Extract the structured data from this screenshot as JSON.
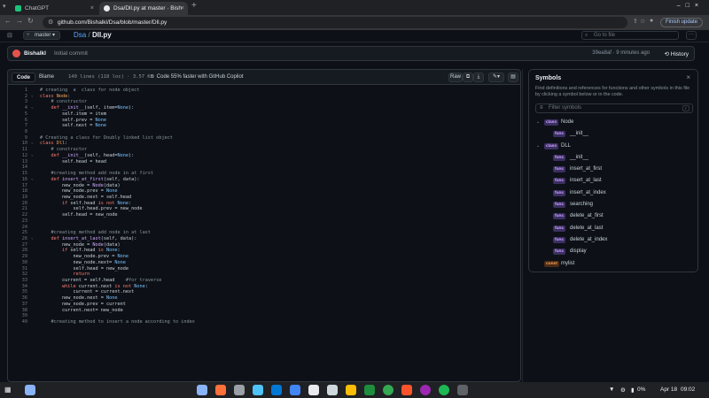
{
  "browser": {
    "tabs": [
      {
        "title": "ChatGPT",
        "favicon_color": "#19c37d"
      },
      {
        "title": "Dsa/Dll.py at master · Bish",
        "favicon_color": "#e8eaed"
      }
    ],
    "new_tab_label": "+",
    "url": "github.com/Bishalkl/Dsa/blob/master/Dll.py",
    "finish_update_label": "Finish update"
  },
  "repo_bar": {
    "branch": "master",
    "repo": "Dsa",
    "separator": "/",
    "file": "Dll.py",
    "goto_placeholder": "Go to file",
    "more_label": "···"
  },
  "commit": {
    "author": "Bishalkl",
    "message": "Initial commit",
    "hash_time": "39ea8af · 9 minutes ago",
    "history_label": "History"
  },
  "code_header": {
    "tab_code": "Code",
    "tab_blame": "Blame",
    "file_info": "140 lines (118 loc) · 3.57 KB",
    "copilot": "Code 55% faster with GitHub Copilot",
    "raw_label": "Raw"
  },
  "code_lines": [
    {
      "n": "1",
      "fold": "",
      "html": "<span class=\"tk-cm\"># creating  a  class for node object</span>"
    },
    {
      "n": "2",
      "fold": "⌄",
      "html": "<span class=\"tk-kw\">class</span> <span class=\"tk-cl\">Node</span>:"
    },
    {
      "n": "3",
      "fold": "",
      "html": "    <span class=\"tk-cm\"># constructor</span>"
    },
    {
      "n": "4",
      "fold": "⌄",
      "html": "    <span class=\"tk-kw\">def</span> <span class=\"tk-fn\">__init__</span>(self, item=<span class=\"tk-bi\">None</span>):"
    },
    {
      "n": "5",
      "fold": "",
      "html": "        self.item = item"
    },
    {
      "n": "6",
      "fold": "",
      "html": "        self.prev = <span class=\"tk-bi\">None</span>"
    },
    {
      "n": "7",
      "fold": "",
      "html": "        self.next = <span class=\"tk-bi\">None</span>"
    },
    {
      "n": "8",
      "fold": "",
      "html": ""
    },
    {
      "n": "9",
      "fold": "",
      "html": "<span class=\"tk-cm\"># Creating a class for Doubly linked list object</span>"
    },
    {
      "n": "10",
      "fold": "⌄",
      "html": "<span class=\"tk-kw\">class</span> <span class=\"tk-cl\">Dll</span>:"
    },
    {
      "n": "11",
      "fold": "",
      "html": "    <span class=\"tk-cm\"># constructor</span>"
    },
    {
      "n": "12",
      "fold": "⌄",
      "html": "    <span class=\"tk-kw\">def</span> <span class=\"tk-fn\">__init__</span>(self, head=<span class=\"tk-bi\">None</span>):"
    },
    {
      "n": "13",
      "fold": "",
      "html": "        self.head = head"
    },
    {
      "n": "14",
      "fold": "",
      "html": ""
    },
    {
      "n": "15",
      "fold": "",
      "html": "    <span class=\"tk-cm\">#creating method add node in at first</span>"
    },
    {
      "n": "16",
      "fold": "⌄",
      "html": "    <span class=\"tk-kw\">def</span> <span class=\"tk-fn\">insert_at_first</span>(self, data):"
    },
    {
      "n": "17",
      "fold": "",
      "html": "        new_node = <span class=\"tk-fn\">Node</span>(data)"
    },
    {
      "n": "18",
      "fold": "",
      "html": "        new_node.prev = <span class=\"tk-bi\">None</span>"
    },
    {
      "n": "19",
      "fold": "",
      "html": "        new_node.next = self.head"
    },
    {
      "n": "20",
      "fold": "",
      "html": "        <span class=\"tk-kw\">if</span> self.head <span class=\"tk-kw\">is not</span> <span class=\"tk-bi\">None</span>:"
    },
    {
      "n": "21",
      "fold": "",
      "html": "            self.head.prev = new_node"
    },
    {
      "n": "22",
      "fold": "",
      "html": "        self.head = new_node"
    },
    {
      "n": "23",
      "fold": "",
      "html": ""
    },
    {
      "n": "24",
      "fold": "",
      "html": ""
    },
    {
      "n": "25",
      "fold": "",
      "html": "    <span class=\"tk-cm\">#creating method add node in at last</span>"
    },
    {
      "n": "26",
      "fold": "⌄",
      "html": "    <span class=\"tk-kw\">def</span> <span class=\"tk-fn\">insert_at_last</span>(self, data):"
    },
    {
      "n": "27",
      "fold": "",
      "html": "        new_node = <span class=\"tk-fn\">Node</span>(data)"
    },
    {
      "n": "28",
      "fold": "",
      "html": "        <span class=\"tk-kw\">if</span> self.head <span class=\"tk-kw\">is</span> <span class=\"tk-bi\">None</span>:"
    },
    {
      "n": "29",
      "fold": "",
      "html": "            new_node.prev = <span class=\"tk-bi\">None</span>"
    },
    {
      "n": "30",
      "fold": "",
      "html": "            new_node.next= <span class=\"tk-bi\">None</span>"
    },
    {
      "n": "31",
      "fold": "",
      "html": "            self.head = new_node"
    },
    {
      "n": "32",
      "fold": "",
      "html": "            <span class=\"tk-kw\">return</span>"
    },
    {
      "n": "33",
      "fold": "",
      "html": "        current = self.head    <span class=\"tk-cm\">#for traverse</span>"
    },
    {
      "n": "34",
      "fold": "",
      "html": "        <span class=\"tk-kw\">while</span> current.next <span class=\"tk-kw\">is not</span> <span class=\"tk-bi\">None</span>:"
    },
    {
      "n": "35",
      "fold": "",
      "html": "            current = current.next"
    },
    {
      "n": "36",
      "fold": "",
      "html": "        new_node.next = <span class=\"tk-bi\">None</span>"
    },
    {
      "n": "37",
      "fold": "",
      "html": "        new_node.prev = current"
    },
    {
      "n": "38",
      "fold": "",
      "html": "        current.next= new_node"
    },
    {
      "n": "39",
      "fold": "",
      "html": ""
    },
    {
      "n": "40",
      "fold": "",
      "html": "    <span class=\"tk-cm\">#creating method to insert a node according to index</span>"
    }
  ],
  "symbols": {
    "title": "Symbols",
    "description": "Find definitions and references for functions and other symbols in this file by clicking a symbol below or in the code.",
    "filter_placeholder": "Filter symbols",
    "filter_kbd": "r",
    "items": [
      {
        "kind": "class",
        "name": "Node",
        "level": 0,
        "expand": "⌄"
      },
      {
        "kind": "func",
        "name": "__init__",
        "level": 1,
        "expand": ""
      },
      {
        "kind": "class",
        "name": "DLL",
        "level": 0,
        "expand": "⌄"
      },
      {
        "kind": "func",
        "name": "__init__",
        "level": 1,
        "expand": ""
      },
      {
        "kind": "func",
        "name": "insert_at_first",
        "level": 1,
        "expand": ""
      },
      {
        "kind": "func",
        "name": "insert_at_last",
        "level": 1,
        "expand": ""
      },
      {
        "kind": "func",
        "name": "insert_at_index",
        "level": 1,
        "expand": ""
      },
      {
        "kind": "func",
        "name": "searching",
        "level": 1,
        "expand": ""
      },
      {
        "kind": "func",
        "name": "delete_at_first",
        "level": 1,
        "expand": ""
      },
      {
        "kind": "func",
        "name": "delete_at_last",
        "level": 1,
        "expand": ""
      },
      {
        "kind": "func",
        "name": "delete_at_index",
        "level": 1,
        "expand": ""
      },
      {
        "kind": "func",
        "name": "display",
        "level": 1,
        "expand": ""
      },
      {
        "kind": "const",
        "name": "mylist",
        "level": 0,
        "expand": ""
      }
    ]
  },
  "taskbar": {
    "apps": [
      {
        "name": "files-app-icon",
        "color": "#8ab4f8"
      },
      {
        "name": "firefox-icon",
        "color": "#ff7139"
      },
      {
        "name": "file-manager-icon",
        "color": "#9aa0a6"
      },
      {
        "name": "screenshot-icon",
        "color": "#4fc3f7"
      },
      {
        "name": "vscode-icon",
        "color": "#0078d4"
      },
      {
        "name": "task-app-icon",
        "color": "#4285f4"
      },
      {
        "name": "inkscape-icon",
        "color": "#e8eaed"
      },
      {
        "name": "gimp-icon",
        "color": "#cfd8dc"
      },
      {
        "name": "photos-icon",
        "color": "#fbbc04"
      },
      {
        "name": "spreadsheet-icon",
        "color": "#1e8e3e"
      },
      {
        "name": "chrome-icon",
        "color": "#34a853"
      },
      {
        "name": "brave-icon",
        "color": "#fb542b"
      },
      {
        "name": "github-desktop-icon",
        "color": "#9c27b0"
      },
      {
        "name": "spotify-icon",
        "color": "#1db954"
      },
      {
        "name": "terminal-icon",
        "color": "#5f6368"
      }
    ],
    "battery": "0%",
    "date": "Apr 18",
    "time": "09:02"
  }
}
